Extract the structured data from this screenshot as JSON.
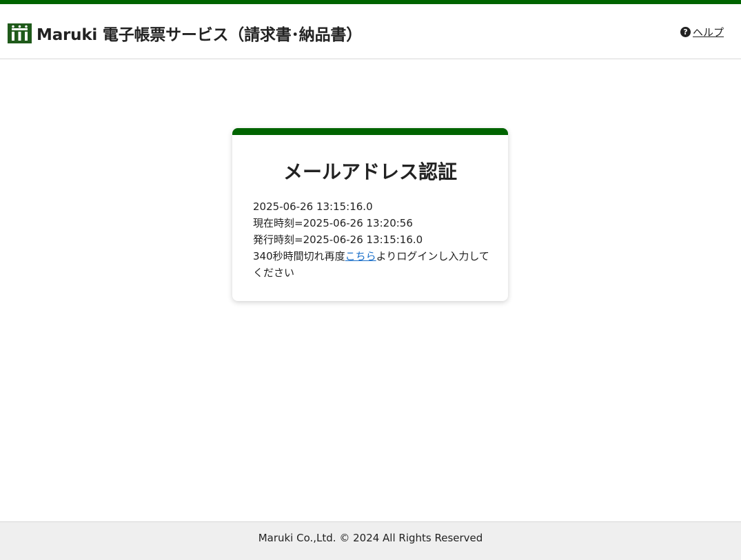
{
  "colors": {
    "brand_green": "#006400",
    "logo_green": "#1f5a1a",
    "link_blue": "#1a6fc9",
    "footer_bg": "#efefef"
  },
  "header": {
    "logo_icon": "maruki-logo-icon",
    "title": "Maruki 電子帳票サービス（請求書･納品書）",
    "help": {
      "icon": "question-circle-icon",
      "icon_glyph": "?",
      "label": "ヘルプ"
    }
  },
  "card": {
    "title": "メールアドレス認証",
    "line1": "2025-06-26 13:15:16.0",
    "line2": "現在時刻=2025-06-26 13:20:56",
    "line3": "発行時刻=2025-06-26 13:15:16.0",
    "line4_before": "340秒時間切れ再度",
    "line4_link": "こちら",
    "line4_after": "よりログインし入力してください"
  },
  "footer": {
    "copyright": "Maruki Co.,Ltd. © 2024 All Rights Reserved"
  }
}
